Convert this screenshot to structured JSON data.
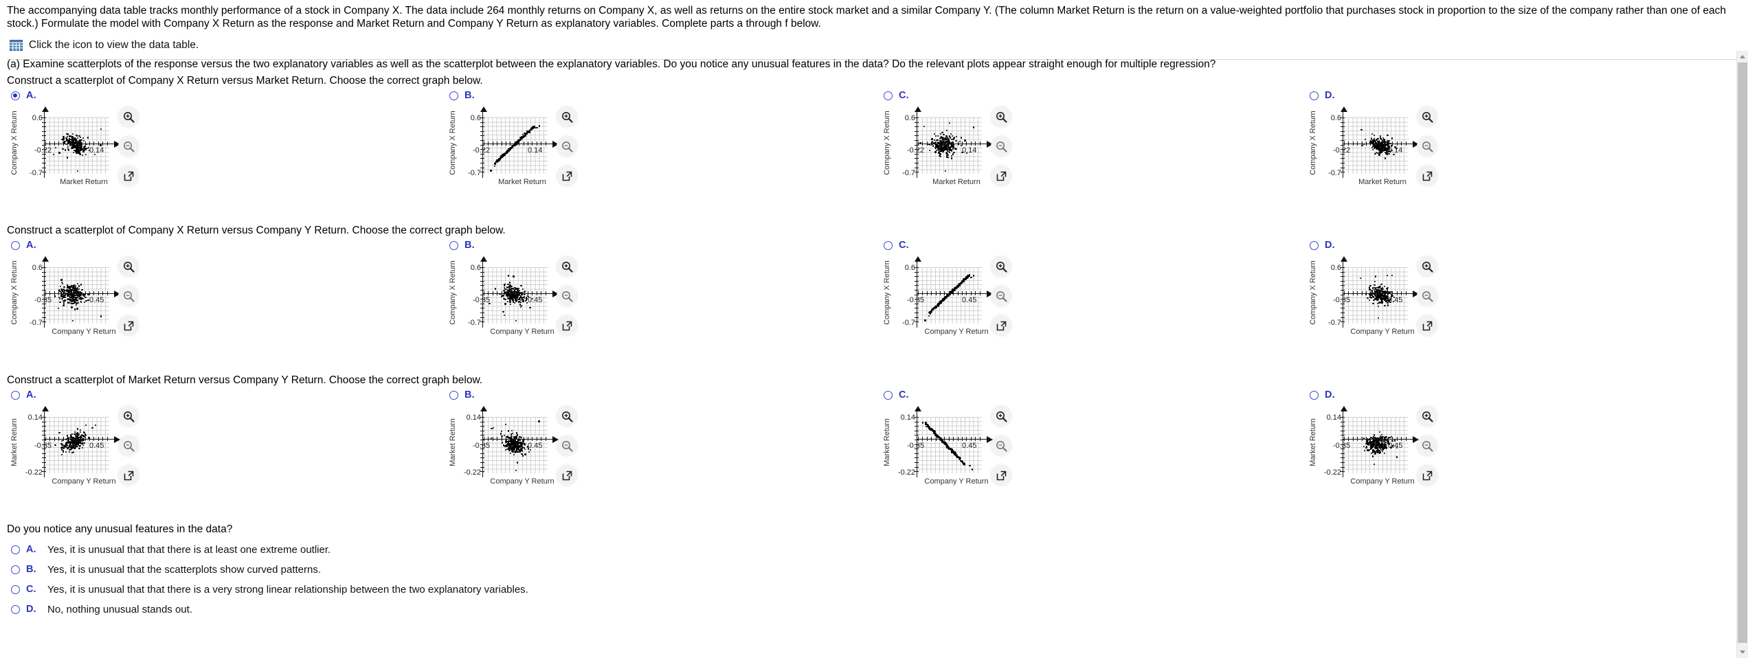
{
  "problem": {
    "statement": "The accompanying data table tracks monthly performance of a stock in Company X. The data include 264 monthly returns on Company X, as well as returns on the entire stock market and a similar Company Y. (The column Market Return is the return on a value-weighted portfolio that purchases stock in proportion to the size of the company rather than one of each stock.) Formulate the model with Company X Return as the response and Market Return and Company Y Return as explanatory variables. Complete parts a through f below.",
    "data_table_link": "Click the icon to view the data table.",
    "part_a": "(a) Examine scatterplots of the response versus the two explanatory variables as well as the scatterplot between the explanatory variables. Do you notice any unusual features in the data? Do the relevant plots appear straight enough for multiple regression?"
  },
  "accent_color": "#2b36b5",
  "controls": {
    "zoom_in": "zoom-in-icon",
    "zoom_out": "zoom-out-icon",
    "open_in_new": "open-in-new-window-icon"
  },
  "groups": [
    {
      "prompt": "Construct a scatterplot of Company X Return versus Market Return. Choose the correct graph below.",
      "selected": "A",
      "axes": {
        "ylabel": "Company X Return",
        "xlabel": "Market Return",
        "ytop": "0.6",
        "ybottom": "-0.7",
        "xleft": "-0.22",
        "xright": "0.14"
      },
      "options": [
        {
          "letter": "A.",
          "checked": true,
          "pattern": "cloud-center"
        },
        {
          "letter": "B.",
          "checked": false,
          "pattern": "band-positive"
        },
        {
          "letter": "C.",
          "checked": false,
          "pattern": "cloud-left"
        },
        {
          "letter": "D.",
          "checked": false,
          "pattern": "cloud-right"
        }
      ]
    },
    {
      "prompt": "Construct a scatterplot of Company X Return versus Company Y Return. Choose the correct graph below.",
      "selected": null,
      "axes": {
        "ylabel": "Company X Return",
        "xlabel": "Company Y Return",
        "ytop": "0.6",
        "ybottom": "-0.7",
        "xleft": "-0.35",
        "xright": "0.45"
      },
      "options": [
        {
          "letter": "A.",
          "checked": false,
          "pattern": "cloud-left"
        },
        {
          "letter": "B.",
          "checked": false,
          "pattern": "cloud-center"
        },
        {
          "letter": "C.",
          "checked": false,
          "pattern": "band-positive"
        },
        {
          "letter": "D.",
          "checked": false,
          "pattern": "cloud-right"
        }
      ]
    },
    {
      "prompt": "Construct a scatterplot of Market Return versus Company Y Return. Choose the correct graph below.",
      "selected": null,
      "axes": {
        "ylabel": "Market Return",
        "xlabel": "Company Y Return",
        "ytop": "0.14",
        "ybottom": "-0.22",
        "xleft": "-0.35",
        "xright": "0.45"
      },
      "options": [
        {
          "letter": "A.",
          "checked": false,
          "pattern": "cloud-up"
        },
        {
          "letter": "B.",
          "checked": false,
          "pattern": "cloud-center"
        },
        {
          "letter": "C.",
          "checked": false,
          "pattern": "band-negative"
        },
        {
          "letter": "D.",
          "checked": false,
          "pattern": "cloud-center2"
        }
      ]
    }
  ],
  "final_question": {
    "prompt": "Do you notice any unusual features in the data?",
    "answers": [
      {
        "letter": "A.",
        "text": "Yes, it is unusual that that there is at least one extreme outlier.",
        "checked": false
      },
      {
        "letter": "B.",
        "text": "Yes, it is unusual that the scatterplots show curved patterns.",
        "checked": false
      },
      {
        "letter": "C.",
        "text": "Yes, it is unusual that that there is a very strong linear relationship between the two explanatory variables.",
        "checked": false
      },
      {
        "letter": "D.",
        "text": "No, nothing unusual stands out.",
        "checked": false
      }
    ]
  },
  "chart_data": {
    "type": "scatter",
    "n_points": 264,
    "plots": [
      {
        "id": "x-vs-market",
        "title": "Company X Return versus Market Return",
        "xlabel": "Market Return",
        "ylabel": "Company X Return",
        "xlim": [
          -0.22,
          0.14
        ],
        "ylim": [
          -0.7,
          0.6
        ],
        "grid": true,
        "correct_option": "A",
        "description": "Dense cloud of points centered near the origin with a slight positive tilt and a few low outliers."
      },
      {
        "id": "x-vs-y",
        "title": "Company X Return versus Company Y Return",
        "xlabel": "Company Y Return",
        "ylabel": "Company X Return",
        "xlim": [
          -0.35,
          0.45
        ],
        "ylim": [
          -0.7,
          0.6
        ],
        "grid": true,
        "description": "Dense cloud of points centered near the origin, with one extreme low outlier."
      },
      {
        "id": "market-vs-y",
        "title": "Market Return versus Company Y Return",
        "xlabel": "Company Y Return",
        "ylabel": "Market Return",
        "xlim": [
          -0.35,
          0.45
        ],
        "ylim": [
          -0.22,
          0.14
        ],
        "grid": true,
        "description": "Dense cloud of points with a positive association and a few low outliers."
      }
    ]
  }
}
